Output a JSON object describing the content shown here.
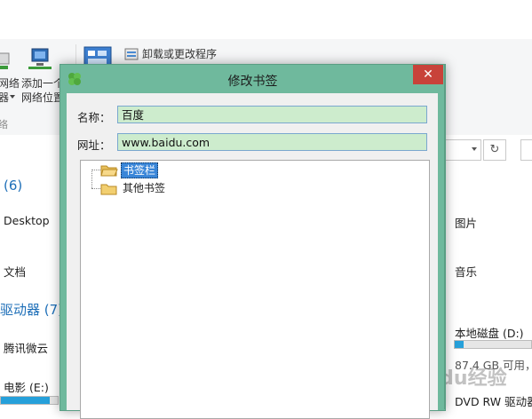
{
  "ribbon": {
    "network_drive_label_1": "网络",
    "network_drive_label_2": "器",
    "add_network_location_1": "添加一个",
    "add_network_location_2": "网络位置",
    "network_group_label": "络",
    "uninstall_label": "卸载或更改程序"
  },
  "content": {
    "folders_section": "(6)",
    "desktop": "Desktop",
    "documents": "文档",
    "pictures": "图片",
    "music": "音乐",
    "drives_section": "驱动器 (7)",
    "tencent_cloud": "腾讯微云",
    "movies_drive": "电影 (E:)",
    "local_disk_d": "本地磁盘 (D:)",
    "local_disk_d_usage": 0.12,
    "movies_drive_usage": 0.86,
    "local_disk_d_free": "87.4 GB 可用，",
    "dvd_drive": "DVD RW 驱动器"
  },
  "dialog": {
    "title": "修改书签",
    "name_label": "名称：",
    "name_value": "百度",
    "url_label": "网址：",
    "url_value": "www.baidu.com",
    "close_glyph": "✕",
    "tree": {
      "items": [
        {
          "label": "书签栏",
          "selected": true
        },
        {
          "label": "其他书签",
          "selected": false
        }
      ]
    }
  },
  "watermark": "Baidu经验",
  "colors": {
    "dialog_frame": "#6fb99d",
    "close_button": "#c8423a",
    "selection": "#3a86d8",
    "input_fill": "#cdeccd",
    "link_blue": "#1e6fb8"
  }
}
